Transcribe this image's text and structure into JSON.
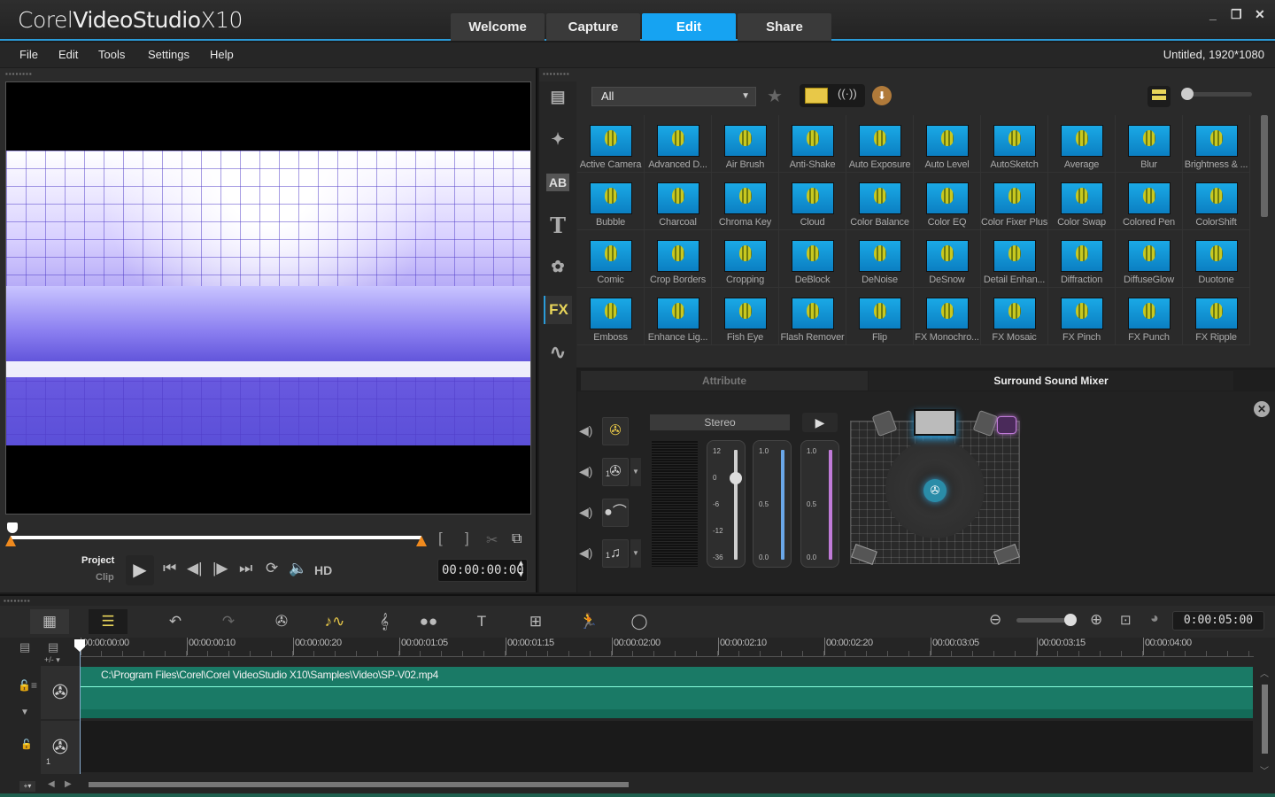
{
  "app": {
    "title_light": "Corel",
    "title_bold": "VideoStudio",
    "title_version": "X10",
    "window_controls": {
      "minimize": "_",
      "restore": "❐",
      "close": "✕"
    }
  },
  "main_tabs": [
    {
      "label": "Welcome",
      "active": false
    },
    {
      "label": "Capture",
      "active": false
    },
    {
      "label": "Edit",
      "active": true
    },
    {
      "label": "Share",
      "active": false
    }
  ],
  "menu": [
    "File",
    "Edit",
    "Tools",
    "Settings",
    "Help"
  ],
  "project_info": "Untitled, 1920*1080",
  "player": {
    "mode_project": "Project",
    "mode_clip": "Clip",
    "hd_label": "HD",
    "timecode": "00:00:00:00",
    "controls": [
      "play",
      "home",
      "previous-frame",
      "next-frame",
      "end",
      "repeat",
      "volume"
    ],
    "mark_in": "[",
    "mark_out": "]"
  },
  "library": {
    "category": "All",
    "sidebar": [
      {
        "name": "media",
        "glyph": "▤"
      },
      {
        "name": "instant-project",
        "glyph": "✦"
      },
      {
        "name": "transition",
        "glyph": "AB"
      },
      {
        "name": "title",
        "glyph": "T"
      },
      {
        "name": "graphic",
        "glyph": "✿"
      },
      {
        "name": "filter",
        "glyph": "FX",
        "active": true
      },
      {
        "name": "path",
        "glyph": "∿"
      }
    ],
    "filters": [
      "Active Camera",
      "Advanced D...",
      "Air Brush",
      "Anti-Shake",
      "Auto Exposure",
      "Auto Level",
      "AutoSketch",
      "Average",
      "Blur",
      "Brightness & ...",
      "Bubble",
      "Charcoal",
      "Chroma Key",
      "Cloud",
      "Color Balance",
      "Color EQ",
      "Color Fixer Plus",
      "Color Swap",
      "Colored Pen",
      "ColorShift",
      "Comic",
      "Crop Borders",
      "Cropping",
      "DeBlock",
      "DeNoise",
      "DeSnow",
      "Detail Enhan...",
      "Diffraction",
      "DiffuseGlow",
      "Duotone",
      "Emboss",
      "Enhance Lig...",
      "Fish Eye",
      "Flash Remover",
      "Flip",
      "FX Monochro...",
      "FX Mosaic",
      "FX Pinch",
      "FX Punch",
      "FX Ripple"
    ]
  },
  "options": {
    "tabs": [
      {
        "label": "Attribute",
        "active": false
      },
      {
        "label": "Surround Sound Mixer",
        "active": true
      }
    ],
    "channel_mode": "Stereo",
    "faders": [
      {
        "name": "volume",
        "scale": [
          "12",
          "0",
          "-6",
          "-12",
          "-36"
        ],
        "color": "#cfcfcf"
      },
      {
        "name": "left-right",
        "scale": [
          "1.0",
          "0.5",
          "0.0"
        ],
        "color": "#6aa7e8"
      },
      {
        "name": "center",
        "scale": [
          "1.0",
          "0.5",
          "0.0"
        ],
        "color": "#c07ad8"
      }
    ],
    "track_channels": [
      {
        "name": "video-track",
        "label": ""
      },
      {
        "name": "overlay-track",
        "label": "1"
      },
      {
        "name": "voice-track",
        "label": ""
      },
      {
        "name": "music-track",
        "label": "1"
      }
    ]
  },
  "timeline": {
    "duration": "0:00:05:00",
    "ruler": [
      "00:00:00:00",
      "00:00:00:10",
      "00:00:00:20",
      "00:00:01:05",
      "00:00:01:15",
      "00:00:02:00",
      "00:00:02:10",
      "00:00:02:20",
      "00:00:03:05",
      "00:00:03:15",
      "00:00:04:00"
    ],
    "add_remove": "+/- ▾",
    "clip_path": "C:\\Program Files\\Corel\\Corel VideoStudio X10\\Samples\\Video\\SP-V02.mp4",
    "overlay_track_number": "1",
    "clip_color": "#1a7a66",
    "accent": "#16a3f2"
  }
}
